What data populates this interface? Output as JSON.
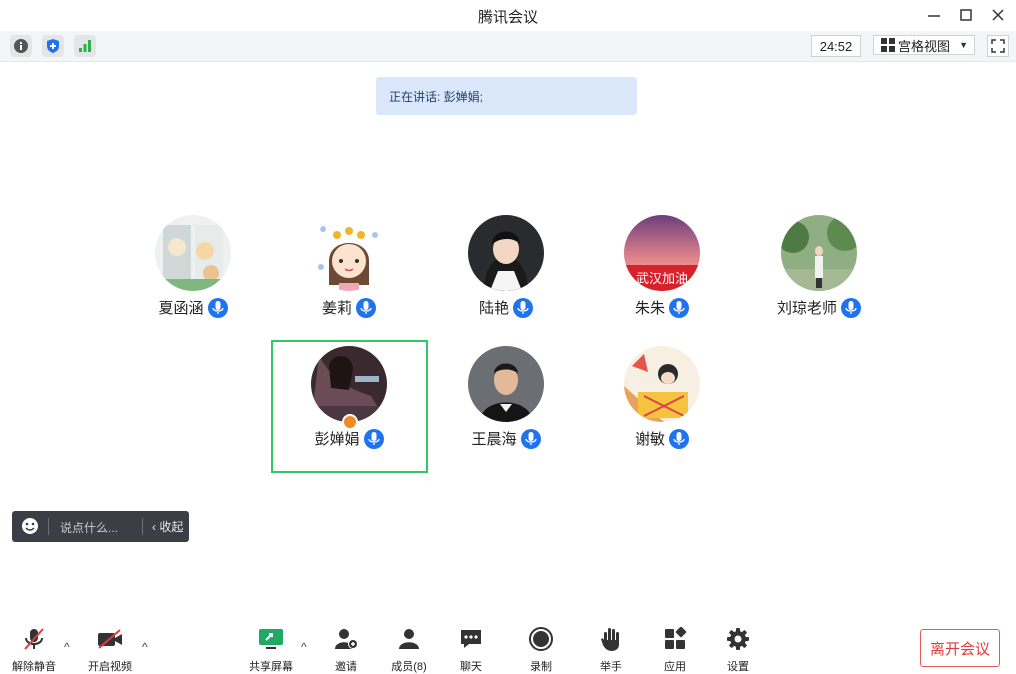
{
  "window": {
    "title": "腾讯会议"
  },
  "topbar": {
    "timer": "24:52",
    "view_label": "宫格视图"
  },
  "speaking_banner": "正在讲话: 彭婵娟;",
  "participants": [
    {
      "name": "夏函涵"
    },
    {
      "name": "姜莉"
    },
    {
      "name": "陆艳"
    },
    {
      "name": "朱朱",
      "avatar_text": "武汉加油"
    },
    {
      "name": "刘琼老师"
    },
    {
      "name": "彭婵娟"
    },
    {
      "name": "王晨海"
    },
    {
      "name": "谢敏"
    }
  ],
  "chat": {
    "placeholder": "说点什么...",
    "collapse": "收起"
  },
  "bottom": {
    "unmute": "解除静音",
    "video": "开启视频",
    "share": "共享屏幕",
    "invite": "邀请",
    "members": "成员(8)",
    "chat": "聊天",
    "record": "录制",
    "hand": "举手",
    "apps": "应用",
    "settings": "设置",
    "leave": "离开会议"
  },
  "colors": {
    "accent": "#1f73f1",
    "active_border": "#34c76a",
    "leave": "#e03b3b"
  }
}
